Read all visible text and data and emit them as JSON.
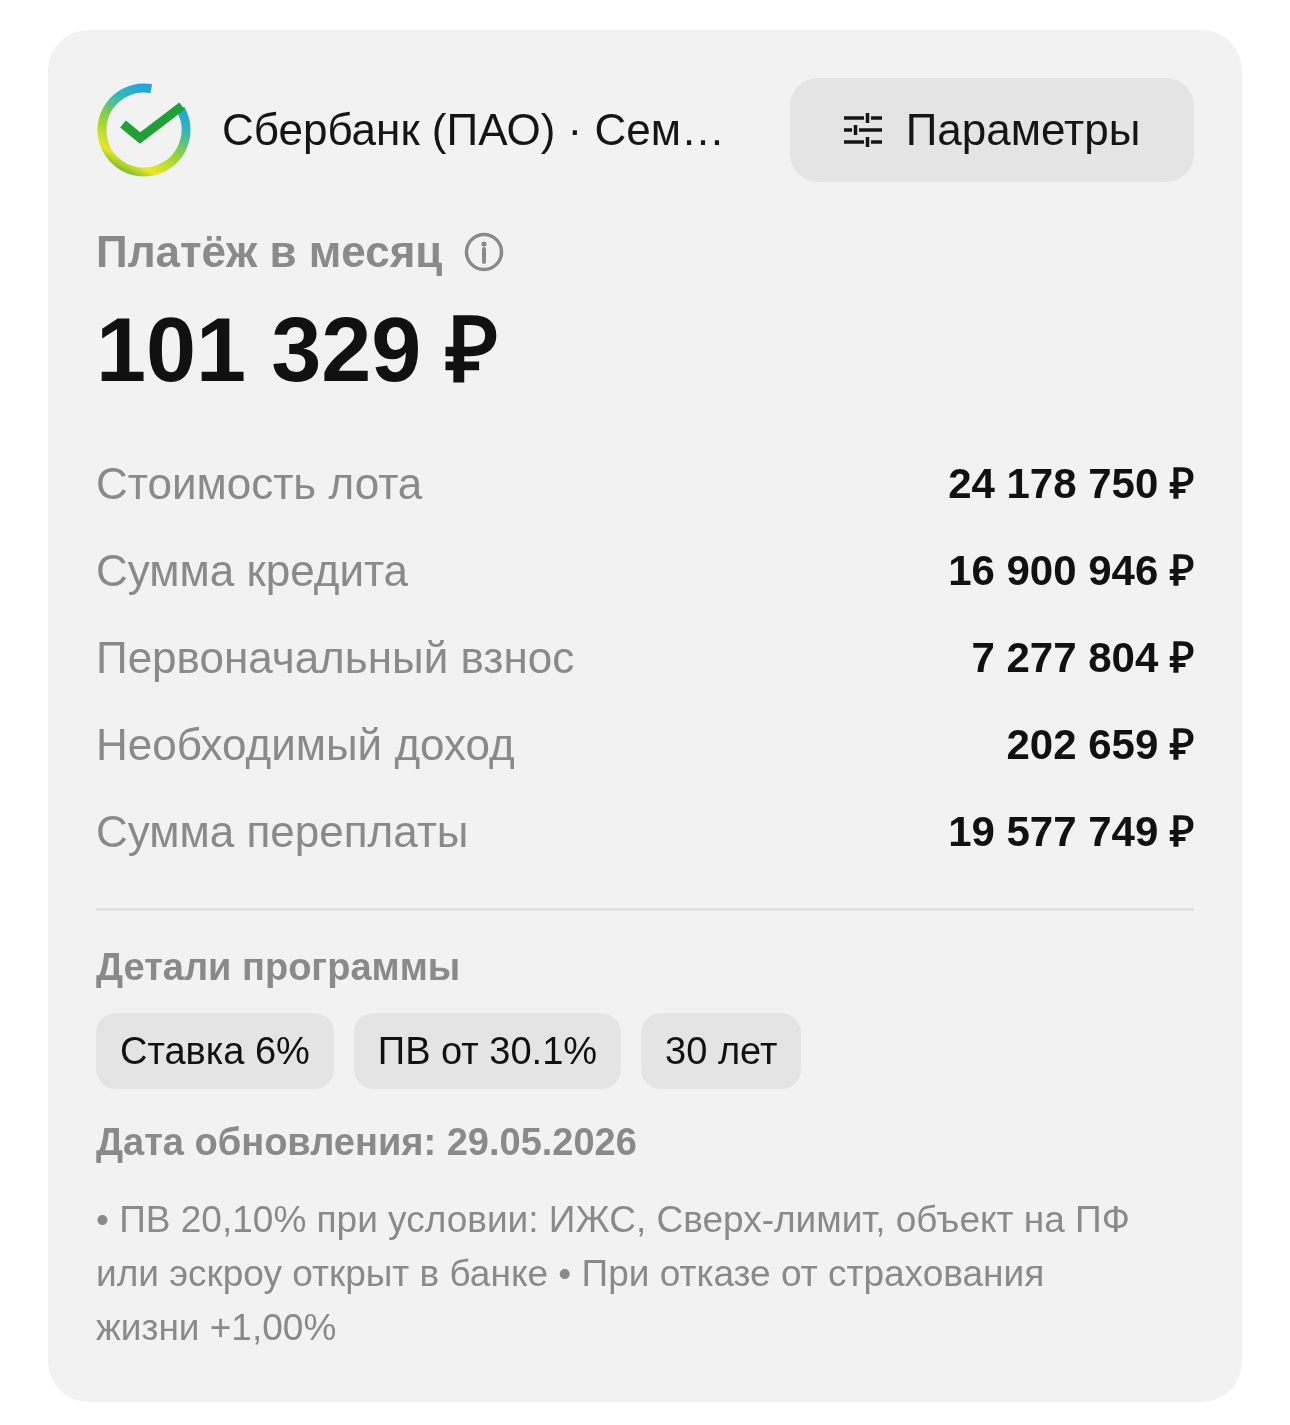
{
  "header": {
    "bank_name": "Сбербанк (ПАО) · Сем…",
    "parameters_button": "Параметры"
  },
  "payment": {
    "label": "Платёж в месяц",
    "amount": "101 329 ₽"
  },
  "summary_rows": [
    {
      "label": "Стоимость лота",
      "value": "24 178 750 ₽"
    },
    {
      "label": "Сумма кредита",
      "value": "16 900 946 ₽"
    },
    {
      "label": "Первоначальный взнос",
      "value": "7 277 804 ₽"
    },
    {
      "label": "Необходимый доход",
      "value": "202 659 ₽"
    },
    {
      "label": "Сумма переплаты",
      "value": "19 577 749 ₽"
    }
  ],
  "program_details": {
    "title": "Детали программы",
    "chips": [
      "Ставка 6%",
      "ПВ от 30.1%",
      "30 лет"
    ]
  },
  "update_date": "Дата обновления: 29.05.2026",
  "notes": "• ПВ 20,10% при условии: ИЖС, Сверх-лимит, объект на ПФ или эскроу открыт в банке • При отказе от страхования жизни +1,00%"
}
